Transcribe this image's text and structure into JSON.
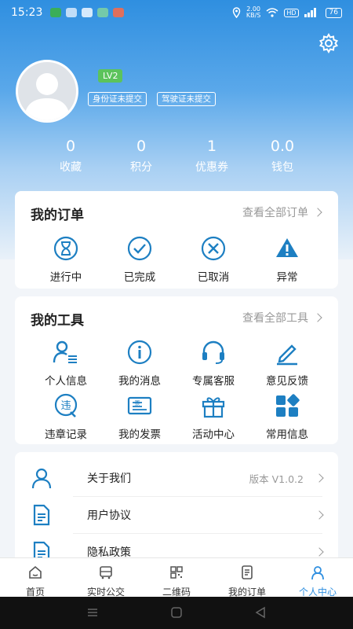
{
  "status_bar": {
    "time": "15:23",
    "net_speed": "2.00",
    "net_unit": "KB/S",
    "hd": "HD",
    "signal": "4G",
    "battery": "76"
  },
  "profile": {
    "level": "LV2",
    "tags": [
      "身份证未提交",
      "驾驶证未提交"
    ]
  },
  "stats": [
    {
      "value": "0",
      "label": "收藏"
    },
    {
      "value": "0",
      "label": "积分"
    },
    {
      "value": "1",
      "label": "优惠券"
    },
    {
      "value": "0.0",
      "label": "钱包"
    }
  ],
  "orders": {
    "title": "我的订单",
    "more": "查看全部订单",
    "items": [
      {
        "label": "进行中",
        "icon": "hourglass-icon"
      },
      {
        "label": "已完成",
        "icon": "check-circle-icon"
      },
      {
        "label": "已取消",
        "icon": "x-circle-icon"
      },
      {
        "label": "异常",
        "icon": "warning-icon"
      }
    ]
  },
  "tools": {
    "title": "我的工具",
    "more": "查看全部工具",
    "items": [
      {
        "label": "个人信息",
        "icon": "person-list-icon"
      },
      {
        "label": "我的消息",
        "icon": "info-icon"
      },
      {
        "label": "专属客服",
        "icon": "headset-icon"
      },
      {
        "label": "意见反馈",
        "icon": "pencil-icon"
      },
      {
        "label": "违章记录",
        "icon": "violation-icon"
      },
      {
        "label": "我的发票",
        "icon": "invoice-icon"
      },
      {
        "label": "活动中心",
        "icon": "gift-icon"
      },
      {
        "label": "常用信息",
        "icon": "blocks-icon"
      }
    ]
  },
  "menu": [
    {
      "label": "关于我们",
      "value": "版本 V1.0.2"
    },
    {
      "label": "用户协议",
      "value": ""
    },
    {
      "label": "隐私政策",
      "value": ""
    }
  ],
  "tabs": [
    {
      "label": "首页"
    },
    {
      "label": "实时公交"
    },
    {
      "label": "二维码"
    },
    {
      "label": "我的订单"
    },
    {
      "label": "个人中心"
    }
  ],
  "colors": {
    "accent": "#2f8fe0",
    "icon": "#1d7fc2",
    "level_badge": "#5cc35c"
  }
}
